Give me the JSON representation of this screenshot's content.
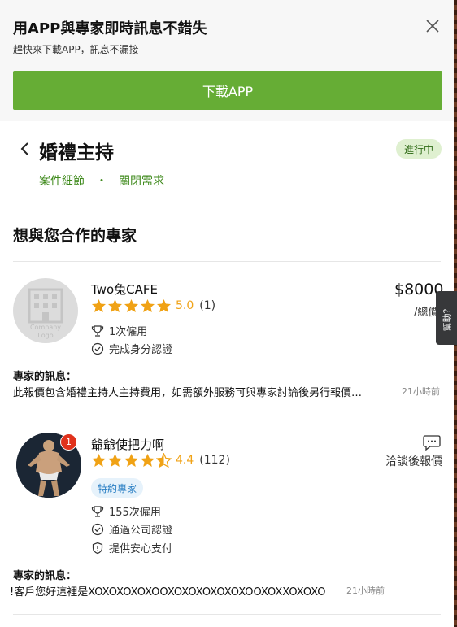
{
  "banner": {
    "title": "用APP與專家即時訊息不錯失",
    "subtitle": "趕快來下載APP，訊息不漏接",
    "download_label": "下載APP"
  },
  "header": {
    "title": "婚禮主持",
    "status": "進行中",
    "link_details": "案件細節",
    "link_separator": "・",
    "link_close": "關閉需求"
  },
  "section_title": "想與您合作的專家",
  "help_label": "幫助？",
  "experts": [
    {
      "name": "Two兔CAFE",
      "rating": "5.0",
      "stars": 5,
      "reviews": "(1)",
      "avatar_placeholder": "Company Logo",
      "hires": "1次僱用",
      "verify": "完成身分認證",
      "price": "$8000",
      "price_unit": "/總價",
      "message_label": "專家的訊息：",
      "message": "此報價包含婚禮主持人主持費用，如需額外服務可與專家討論後另行報價…",
      "time": "21小時前"
    },
    {
      "name": "爺爺使把力啊",
      "rating": "4.4",
      "stars": 4.5,
      "reviews": "(112)",
      "notification_count": "1",
      "premium_badge": "特約專家",
      "hires": "155次僱用",
      "verify": "通過公司認證",
      "payment": "提供安心支付",
      "quote": "洽談後報價",
      "message_label": "專家的訊息：",
      "message": "!客戶您好這裡是XOXOXOXOXOOXOXOXOXOXOXOOXOXXOXOXO",
      "time": "21小時前"
    }
  ],
  "colors": {
    "brand_green": "#66ad35",
    "star_orange": "#f0a215",
    "badge_red": "#e0321c"
  }
}
